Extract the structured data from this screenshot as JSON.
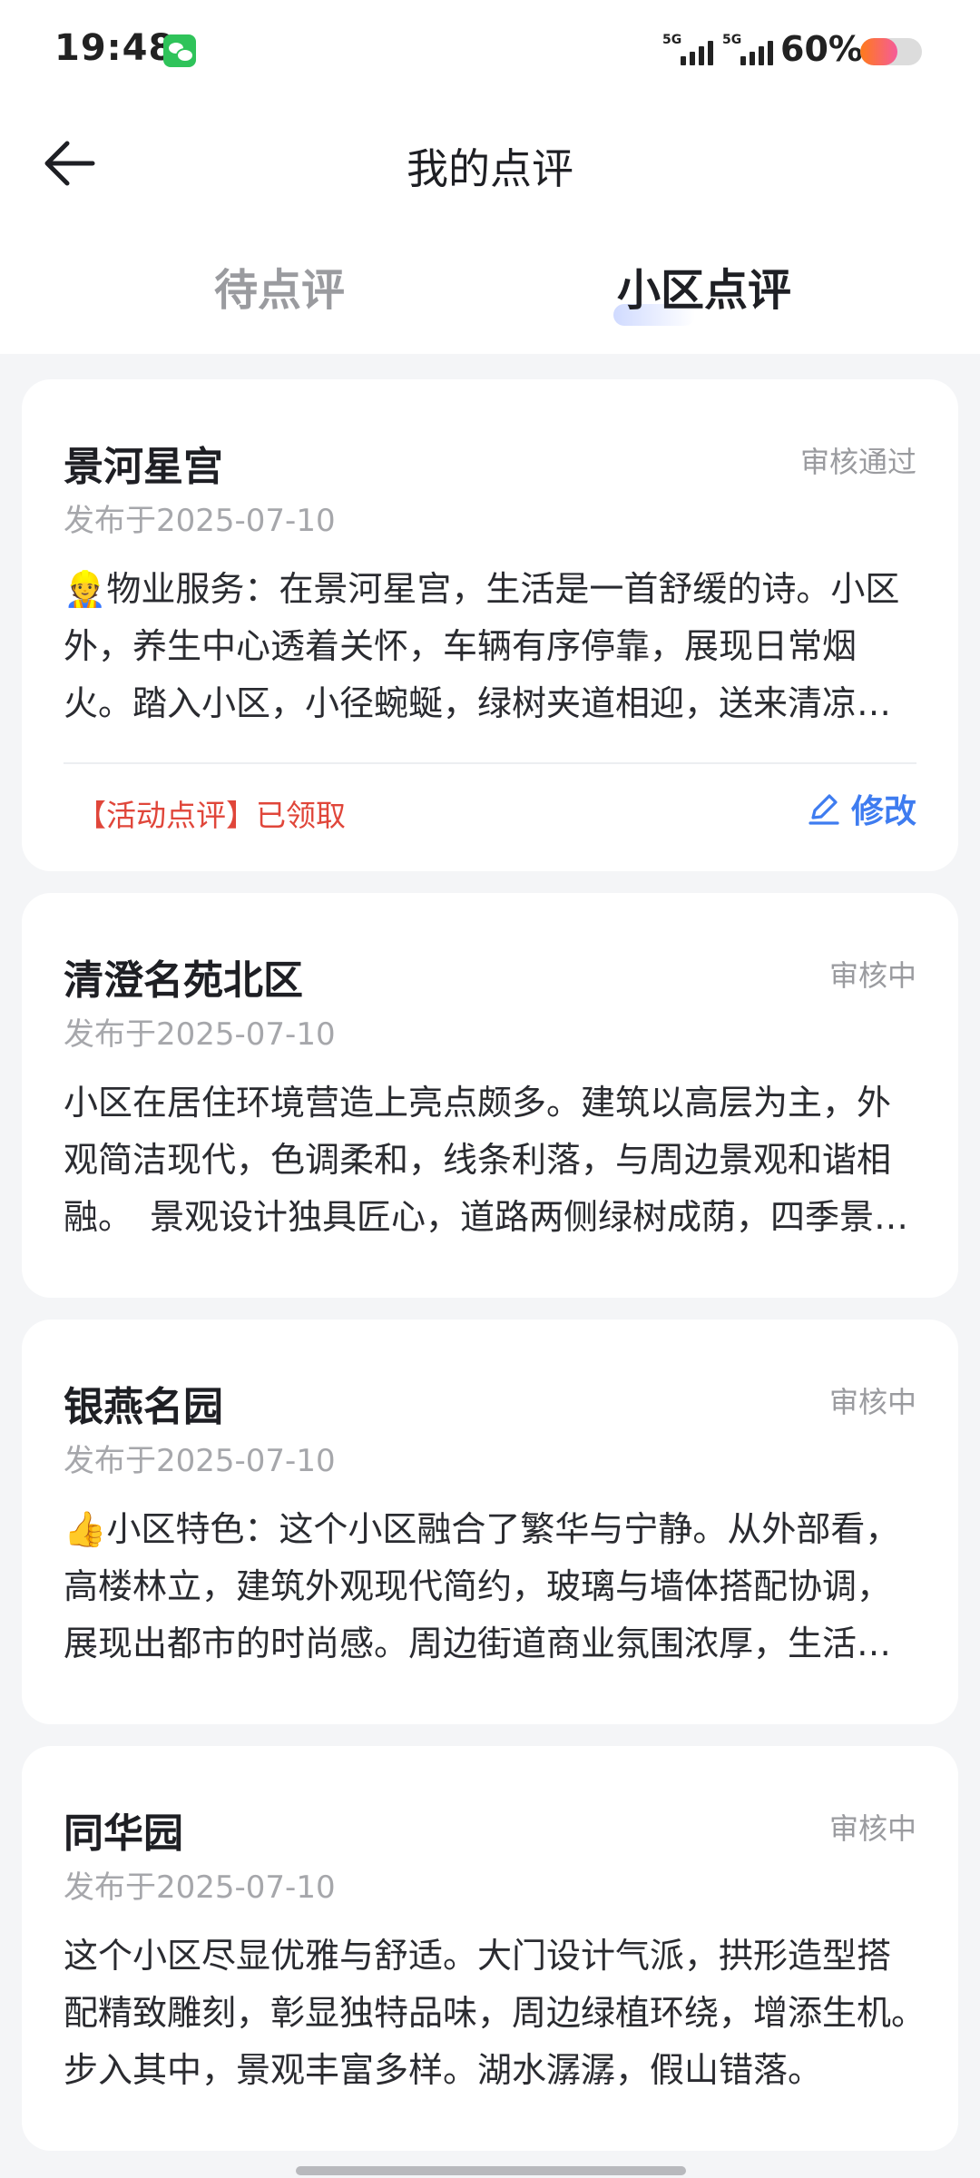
{
  "status_bar": {
    "time": "19:48",
    "signal_1": "5G",
    "signal_2": "5G",
    "battery": "60%",
    "battery_level": 0.6
  },
  "header": {
    "title": "我的点评",
    "tabs": [
      {
        "label": "待点评",
        "active": false
      },
      {
        "label": "小区点评",
        "active": true
      }
    ]
  },
  "reviews": [
    {
      "name": "景河星宫",
      "status": "审核通过",
      "date": "发布于2025-07-10",
      "content": "👷物业服务：在景河星宫，生活是一首舒缓的诗。小区外，养生中心透着关怀，车辆有序停靠，展现日常烟火。踏入小区，小径蜿蜒，绿树夹道相迎，送来清凉与宁静。",
      "activity": "【活动点评】已领取",
      "edit_label": "修改"
    },
    {
      "name": "清澄名苑北区",
      "status": "审核中",
      "date": "发布于2025-07-10",
      "content": "小区在居住环境营造上亮点颇多。建筑以高层为主，外观简洁现代，色调柔和，线条利落，与周边景观和谐相融。　景观设计独具匠心，道路两侧绿树成荫，四季景致各异。"
    },
    {
      "name": "银燕名园",
      "status": "审核中",
      "date": "发布于2025-07-10",
      "content": "👍小区特色：这个小区融合了繁华与宁静。从外部看，高楼林立，建筑外观现代简约，玻璃与墙体搭配协调，展现出都市的时尚感。周边街道商业氛围浓厚，生活便利。"
    },
    {
      "name": "同华园",
      "status": "审核中",
      "date": "发布于2025-07-10",
      "content": "这个小区尽显优雅与舒适。大门设计气派，拱形造型搭配精致雕刻，彰显独特品味，周边绿植环绕，增添生机。　步入其中，景观丰富多样。湖水潺潺，假山错落。"
    }
  ],
  "colors": {
    "accent": "#3e7cf0",
    "activity": "#e0463a",
    "status": "#9a9b9f"
  },
  "icons": [
    "back-arrow-icon",
    "wechat-icon",
    "signal-icon",
    "battery-icon",
    "edit-pencil-icon"
  ]
}
